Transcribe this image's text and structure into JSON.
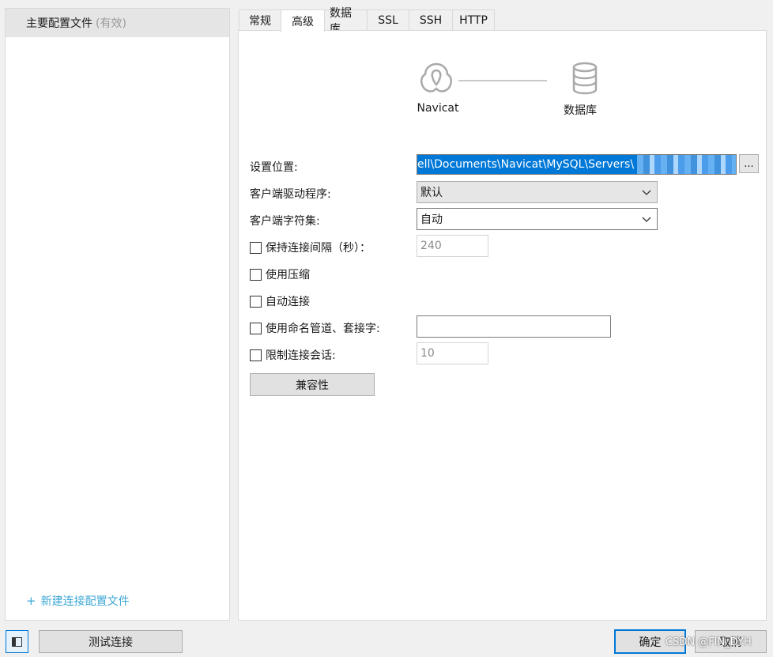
{
  "profiles": {
    "items": [
      {
        "name": "主要配置文件",
        "status": "(有效)"
      }
    ],
    "new_profile_label": "新建连接配置文件"
  },
  "tabs": [
    {
      "label": "常规"
    },
    {
      "label": "高级",
      "active": true
    },
    {
      "label": "数据库"
    },
    {
      "label": "SSL"
    },
    {
      "label": "SSH"
    },
    {
      "label": "HTTP"
    }
  ],
  "diagram": {
    "left_label": "Navicat",
    "right_label": "数据库",
    "left_icon": "navicat-logo-icon",
    "right_icon": "database-icon"
  },
  "form": {
    "settings_location": {
      "label": "设置位置:",
      "value": "ell\\Documents\\Navicat\\MySQL\\Servers\\",
      "browse_label": "..."
    },
    "client_driver": {
      "label": "客户端驱动程序:",
      "value": "默认"
    },
    "client_charset": {
      "label": "客户端字符集:",
      "value": "自动"
    },
    "keepalive": {
      "label": "保持连接间隔（秒）：",
      "value": "240",
      "checked": false
    },
    "compression": {
      "label": "使用压缩",
      "checked": false
    },
    "auto_connect": {
      "label": "自动连接",
      "checked": false
    },
    "named_pipe": {
      "label": "使用命名管道、套接字:",
      "value": "",
      "checked": false
    },
    "limit_sessions": {
      "label": "限制连接会话:",
      "value": "10",
      "checked": false
    },
    "compat_button": "兼容性"
  },
  "footer": {
    "test_button": "测试连接",
    "ok_button": "确定",
    "cancel_button": "取消",
    "watermark": "CSDN @FIN_DYH"
  },
  "colors": {
    "accent": "#0078d7",
    "link": "#3da7d6",
    "selected_item_bg": "#e5e5e5"
  }
}
